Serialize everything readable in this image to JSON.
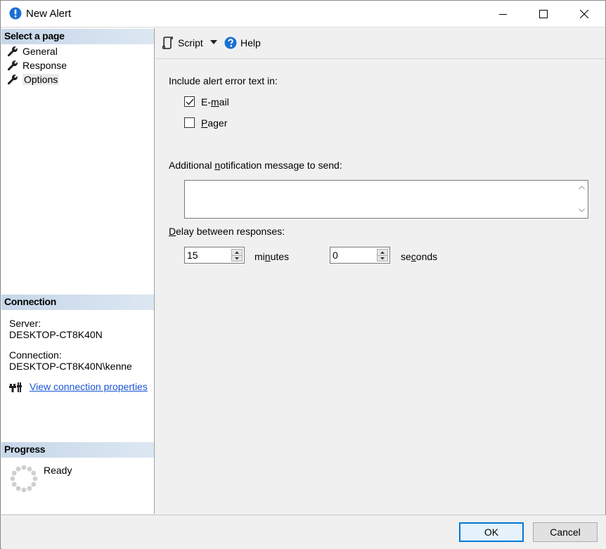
{
  "window": {
    "title": "New Alert"
  },
  "left": {
    "select_page_header": "Select a page",
    "pages": [
      {
        "label": "General"
      },
      {
        "label": "Response"
      },
      {
        "label": "Options"
      }
    ],
    "connection_header": "Connection",
    "server_label": "Server:",
    "server_value": "DESKTOP-CT8K40N",
    "connection_label": "Connection:",
    "connection_value": "DESKTOP-CT8K40N\\kenne",
    "view_props_link": "View connection properties",
    "progress_header": "Progress",
    "progress_status": "Ready"
  },
  "toolbar": {
    "script_label": "Script",
    "help_label": "Help"
  },
  "options": {
    "include_label": "Include alert error text in:",
    "email_label_pre": "E-",
    "email_label_u": "m",
    "email_label_post": "ail",
    "email_checked": true,
    "pager_label_u": "P",
    "pager_label_post": "ager",
    "pager_checked": false,
    "additional_pre": "Additional ",
    "additional_u": "n",
    "additional_post": "otification message to send:",
    "additional_value": "",
    "delay_u": "D",
    "delay_post": "elay between responses:",
    "minutes_value": "15",
    "minutes_pre": "mi",
    "minutes_u": "n",
    "minutes_post": "utes",
    "seconds_value": "0",
    "seconds_pre": "se",
    "seconds_u": "c",
    "seconds_post": "onds"
  },
  "footer": {
    "ok_label": "OK",
    "cancel_label": "Cancel"
  },
  "colors": {
    "accent": "#0078d7",
    "link": "#1a55d6",
    "title_icon": "#1a6fd4"
  }
}
